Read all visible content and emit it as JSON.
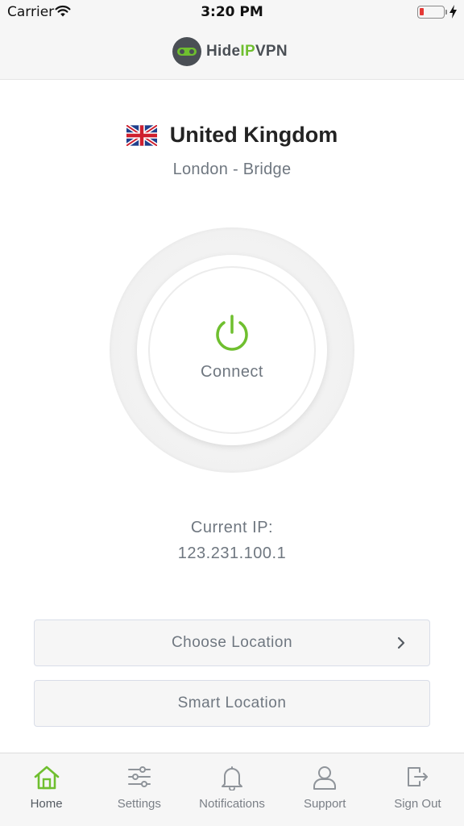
{
  "status_bar": {
    "carrier": "Carrier",
    "time": "3:20 PM"
  },
  "header": {
    "brand_prefix": "Hide",
    "brand_highlight": "IP",
    "brand_suffix": "VPN"
  },
  "location": {
    "country": "United Kingdom",
    "city": "London - Bridge",
    "flag_icon": "uk-flag-icon"
  },
  "connect": {
    "label": "Connect",
    "accent_color": "#6fbf2f"
  },
  "ip": {
    "label": "Current IP:",
    "value": "123.231.100.1"
  },
  "buttons": {
    "choose_location": "Choose Location",
    "smart_location": "Smart Location"
  },
  "tabs": [
    {
      "label": "Home",
      "icon": "home-icon",
      "active": true
    },
    {
      "label": "Settings",
      "icon": "sliders-icon",
      "active": false
    },
    {
      "label": "Notifications",
      "icon": "bell-icon",
      "active": false
    },
    {
      "label": "Support",
      "icon": "user-icon",
      "active": false
    },
    {
      "label": "Sign Out",
      "icon": "sign-out-icon",
      "active": false
    }
  ],
  "colors": {
    "accent": "#6fbf2f",
    "text_muted": "#6f7780",
    "battery_low": "#e53935"
  }
}
